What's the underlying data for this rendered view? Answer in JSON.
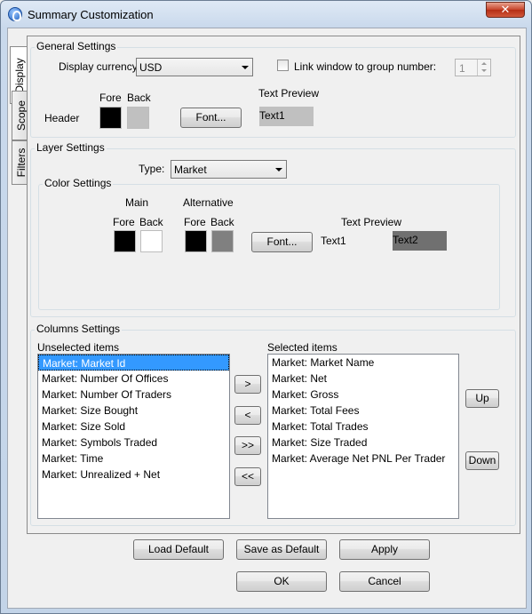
{
  "window": {
    "title": "Summary Customization",
    "close_glyph": "✕"
  },
  "tabs": [
    {
      "label": "Display",
      "active": true
    },
    {
      "label": "Scope",
      "active": false
    },
    {
      "label": "Filters",
      "active": false
    }
  ],
  "general": {
    "title": "General Settings",
    "currency_label": "Display currency:",
    "currency_value": "USD",
    "link_label": "Link window to group number:",
    "link_checked": false,
    "group_number": "1",
    "fore_label": "Fore",
    "back_label": "Back",
    "header_label": "Header",
    "font_button": "Font...",
    "text_preview_label": "Text Preview",
    "preview_text": "Text1",
    "colors": {
      "fore": "#000000",
      "back": "#c0c0c0",
      "preview_bg": "#c0c0c0"
    }
  },
  "layer": {
    "title": "Layer Settings",
    "type_label": "Type:",
    "type_value": "Market",
    "color_title": "Color Settings",
    "main_label": "Main",
    "alt_label": "Alternative",
    "fore_label": "Fore",
    "back_label": "Back",
    "font_button": "Font...",
    "text_preview_label": "Text Preview",
    "preview_text1": "Text1",
    "preview_text2": "Text2",
    "colors": {
      "main_fore": "#000000",
      "main_back": "#ffffff",
      "alt_fore": "#000000",
      "alt_back": "#808080",
      "preview2_bg": "#707070"
    }
  },
  "columns": {
    "title": "Columns Settings",
    "unselected_label": "Unselected items",
    "selected_label": "Selected items",
    "unselected": [
      "Market: Market Id",
      "Market: Number Of Offices",
      "Market: Number Of Traders",
      "Market: Size Bought",
      "Market: Size Sold",
      "Market: Symbols Traded",
      "Market: Time",
      "Market: Unrealized + Net"
    ],
    "selected": [
      "Market: Market Name",
      "Market: Net",
      "Market: Gross",
      "Market: Total Fees",
      "Market: Total Trades",
      "Market: Size Traded",
      "Market: Average Net PNL Per Trader"
    ],
    "move_right": ">",
    "move_left": "<",
    "move_all_right": ">>",
    "move_all_left": "<<",
    "up": "Up",
    "down": "Down"
  },
  "footer": {
    "load_default": "Load Default",
    "save_default": "Save as Default",
    "apply": "Apply",
    "ok": "OK",
    "cancel": "Cancel"
  },
  "colors": {
    "selection": "#3399ff",
    "window_frame": "#c3d4e8",
    "close_button": "#c7432a"
  },
  "icons": {
    "app": "app-circle-icon",
    "close": "close-icon"
  }
}
